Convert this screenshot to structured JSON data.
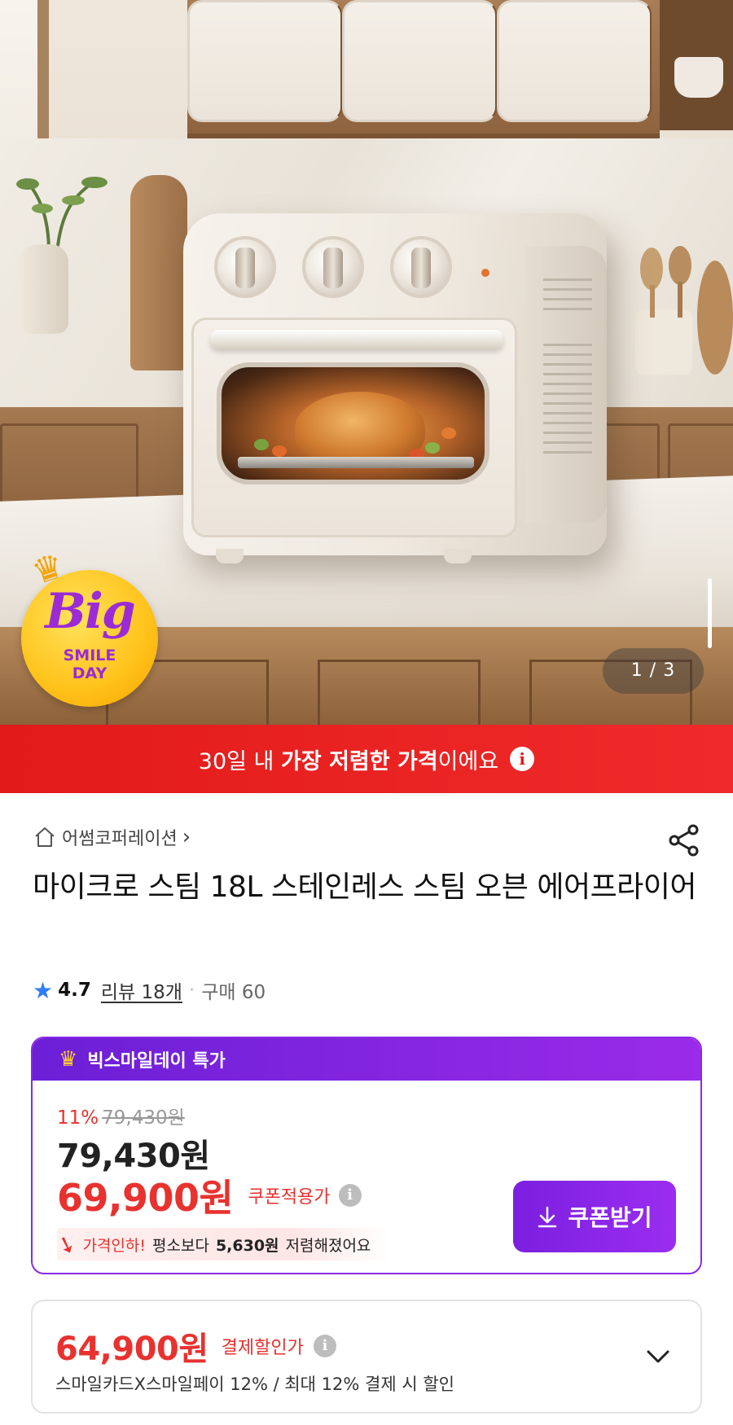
{
  "hero": {
    "image_counter": "1 / 3",
    "badge": {
      "line1": "Big",
      "line2": "SMILE",
      "line3": "DAY"
    }
  },
  "banner": {
    "pre": "30일 내 ",
    "emph": "가장 저렴한 가격",
    "post": "이에요",
    "info_icon": "i"
  },
  "store": {
    "name": "어썸코퍼레이션",
    "chevron": "›"
  },
  "product": {
    "title": "마이크로 스팀 18L 스테인레스 스팀 오븐 에어프라이어"
  },
  "rating": {
    "score": "4.7",
    "reviews": "리뷰 18개",
    "separator": "·",
    "purchases": "구매 60"
  },
  "price_card": {
    "header": "빅스마일데이 특가",
    "discount_pct": "11%",
    "original_price": "79,430원",
    "sale_price": "79,430원",
    "coupon_price": "69,900원",
    "coupon_price_label": "쿠폰적용가",
    "info_icon": "i",
    "drop_lead": "가격인하!",
    "drop_mid": "평소보다",
    "drop_amount": "5,630원",
    "drop_tail": "저렴해졌어요",
    "coupon_button": "쿠폰받기",
    "accent_color": "#8a2be2"
  },
  "payment_card": {
    "price": "64,900원",
    "label": "결제할인가",
    "info_icon": "i",
    "description": "스마일카드X스마일페이 12% / 최대 12% 결제 시 할인"
  },
  "colors": {
    "red": "#e8322f",
    "banner_red": "#e21a1a",
    "purple": "#8a2be2",
    "star_blue": "#2f7df6"
  },
  "icons": {
    "home": "home-icon",
    "share": "share-icon",
    "star": "star-icon",
    "crown": "crown-icon",
    "download": "download-icon",
    "chevron_down": "chevron-down-icon",
    "info": "info-icon"
  }
}
